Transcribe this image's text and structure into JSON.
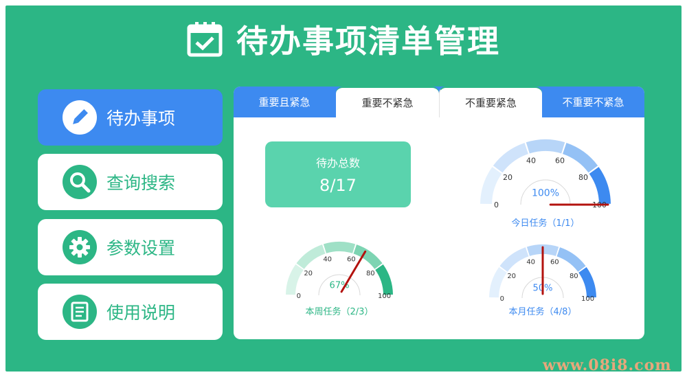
{
  "app": {
    "title": "待办事项清单管理"
  },
  "sidebar": {
    "items": [
      {
        "label": "待办事项",
        "icon": "pencil-icon",
        "active": true
      },
      {
        "label": "查询搜索",
        "icon": "search-icon",
        "active": false
      },
      {
        "label": "参数设置",
        "icon": "gear-icon",
        "active": false
      },
      {
        "label": "使用说明",
        "icon": "document-icon",
        "active": false
      }
    ]
  },
  "tabs": [
    {
      "label": "重要且紧急"
    },
    {
      "label": "重要不紧急"
    },
    {
      "label": "不重要紧急"
    },
    {
      "label": "不重要不紧急"
    }
  ],
  "summary": {
    "label": "待办总数",
    "value": "8/17"
  },
  "gauges": {
    "today": {
      "caption": "今日任务（1/1）",
      "percent_label": "100%",
      "value": 100,
      "color": "#3d8af0"
    },
    "week": {
      "caption": "本周任务（2/3）",
      "percent_label": "67%",
      "value": 67,
      "color": "#2cb685"
    },
    "month": {
      "caption": "本月任务（4/8）",
      "percent_label": "50%",
      "value": 50,
      "color": "#3d8af0"
    }
  },
  "gauge_ticks": [
    "0",
    "20",
    "40",
    "60",
    "80",
    "100"
  ],
  "colors": {
    "brand_green": "#2cb685",
    "brand_blue": "#3d8af0",
    "needle": "#b3120e"
  },
  "watermark": "www.08i8.com"
}
